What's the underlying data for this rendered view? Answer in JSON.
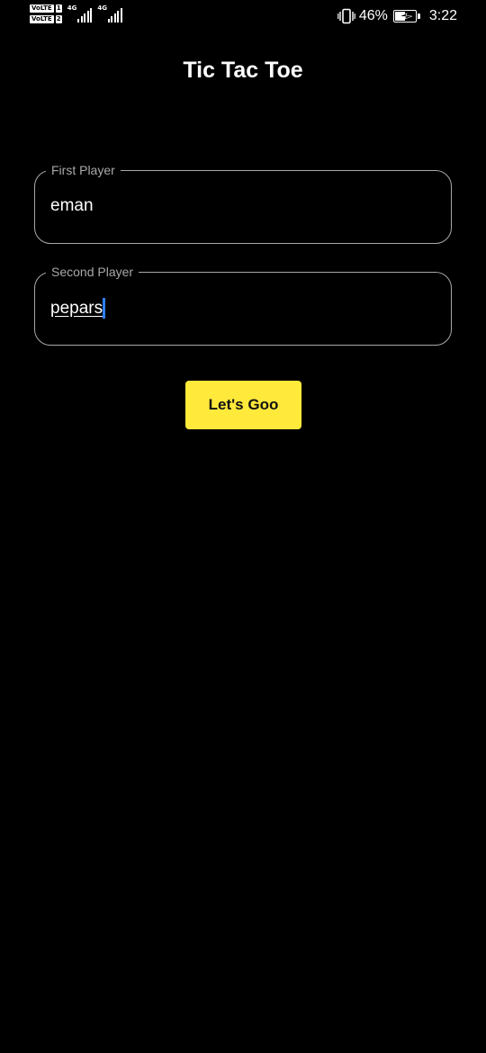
{
  "status_bar": {
    "sim1_badge": "VoLTE",
    "sim1_num": "1",
    "sim2_badge": "VoLTE",
    "sim2_num": "2",
    "net1": "4G",
    "net2": "4G",
    "battery_percent": "46%",
    "time": "3:22",
    "icons": [
      "volte-icon",
      "signal-icon",
      "vibrate-icon",
      "battery-charging-icon"
    ]
  },
  "app": {
    "title": "Tic Tac Toe"
  },
  "form": {
    "first_player": {
      "label": "First Player",
      "value": "eman"
    },
    "second_player": {
      "label": "Second Player",
      "value": "pepars"
    },
    "submit_label": "Let's Goo"
  },
  "colors": {
    "background": "#000000",
    "accent": "#ffe93b",
    "field_border": "#a8a8a8",
    "caret": "#2f7ff0"
  }
}
